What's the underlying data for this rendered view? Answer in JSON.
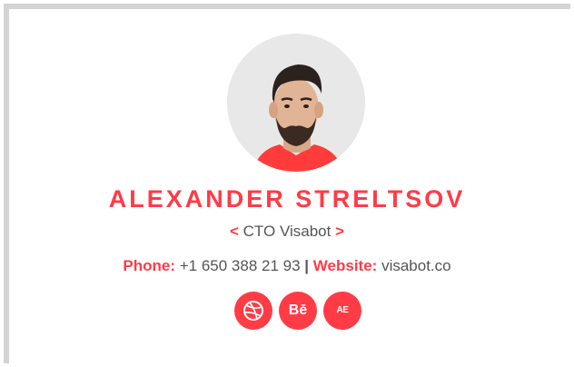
{
  "signature": {
    "name": "ALEXANDER STRELTSOV",
    "role_open": "<",
    "role": "CTO Visabot",
    "role_close": ">",
    "phone_label": "Phone:",
    "phone": "+1 650 388 21 93",
    "separator": "|",
    "website_label": "Website:",
    "website": "visabot.co",
    "socials": [
      {
        "icon": "dribbble-icon",
        "text": ""
      },
      {
        "icon": "behance-icon",
        "text": "Bē"
      },
      {
        "icon": "angellist-icon",
        "text": "AE"
      }
    ]
  },
  "colors": {
    "accent": "#ff3b46",
    "text": "#555555",
    "border": "#d4d4d4"
  }
}
